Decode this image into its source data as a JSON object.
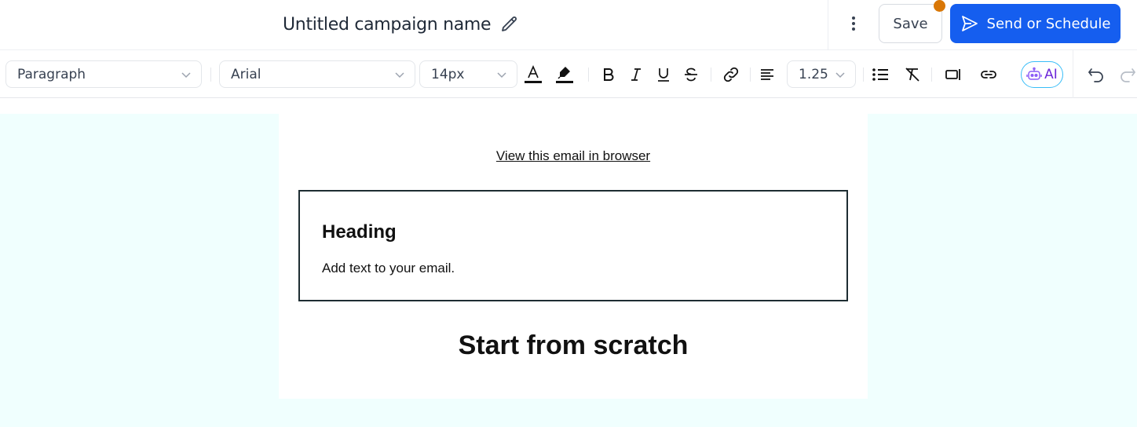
{
  "header": {
    "campaign_name": "Untitled campaign name",
    "save_label": "Save",
    "send_label": "Send or Schedule",
    "icons": {
      "edit": "pencil-icon",
      "more": "kebab-menu-icon",
      "send": "send-icon"
    }
  },
  "toolbar": {
    "block_type": "Paragraph",
    "font_family": "Arial",
    "font_size": "14px",
    "line_height": "1.25",
    "ai_label": "AI",
    "icons": [
      "text-color-icon",
      "highlight-icon",
      "bold-icon",
      "italic-icon",
      "underline-icon",
      "strikethrough-icon",
      "link-icon",
      "align-left-icon",
      "bullet-list-icon",
      "clear-format-icon",
      "merge-tag-icon",
      "button-link-icon",
      "ai-robot-icon",
      "undo-icon",
      "redo-icon"
    ]
  },
  "email": {
    "view_in_browser": "View this email in browser",
    "block_heading": "Heading",
    "block_text": "Add text to your email.",
    "scratch_heading": "Start from scratch"
  },
  "colors": {
    "primary": "#155eef",
    "unsaved_dot": "#d97706",
    "canvas_bg": "#f0fffe",
    "ai_accent": "#6d28d9"
  }
}
